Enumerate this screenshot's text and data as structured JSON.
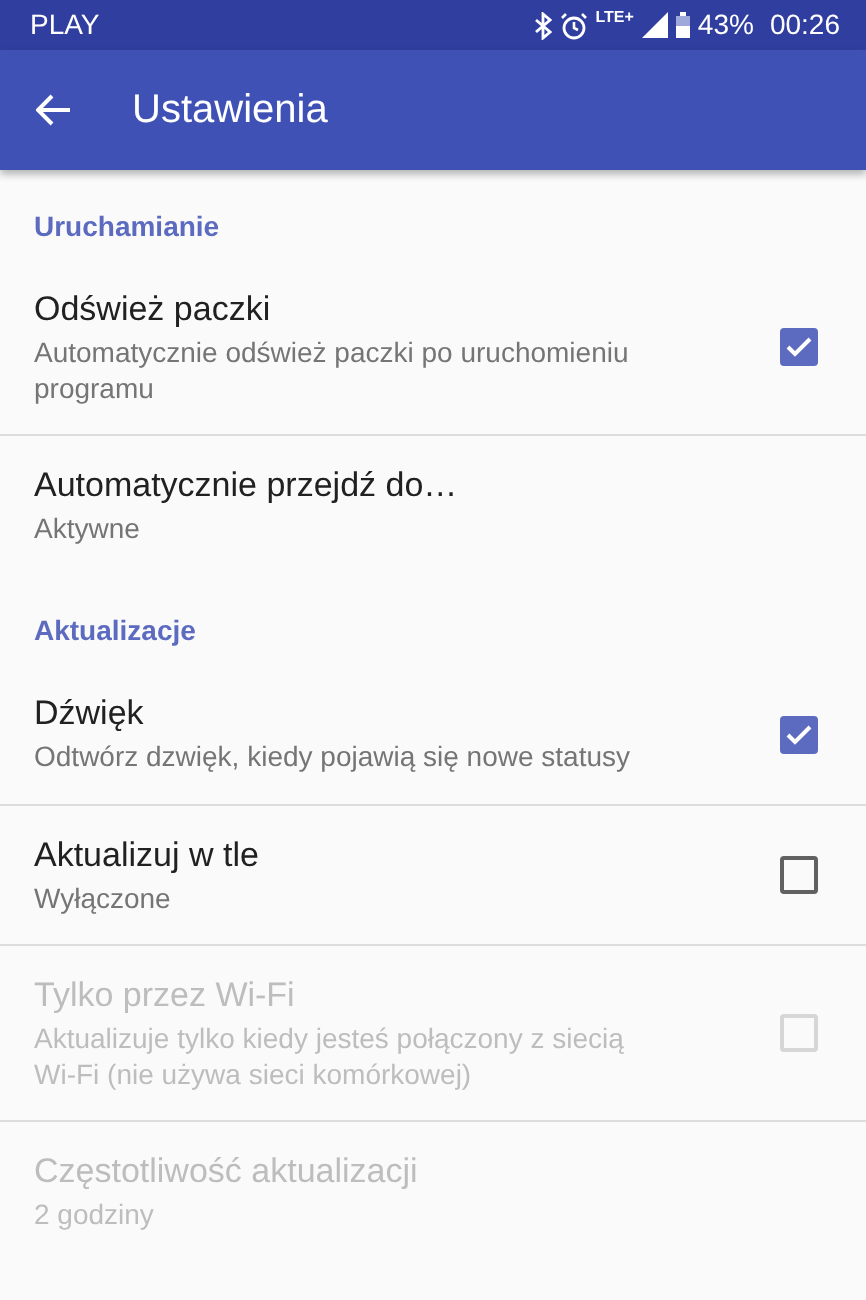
{
  "status_bar": {
    "carrier": "PLAY",
    "network": "LTE+",
    "battery": "43%",
    "time": "00:26"
  },
  "app_bar": {
    "title": "Ustawienia"
  },
  "sections": [
    {
      "title": "Uruchamianie",
      "items": [
        {
          "kind": "checkbox",
          "title": "Odśwież paczki",
          "summary": "Automatycznie odśwież paczki po uruchomieniu programu",
          "checked": true,
          "disabled": false
        },
        {
          "kind": "plain",
          "title": "Automatycznie przejdź do…",
          "summary": "Aktywne",
          "disabled": false
        }
      ]
    },
    {
      "title": "Aktualizacje",
      "items": [
        {
          "kind": "checkbox",
          "title": "Dźwięk",
          "summary": "Odtwórz dzwięk, kiedy pojawią się nowe statusy",
          "checked": true,
          "disabled": false
        },
        {
          "kind": "checkbox",
          "title": "Aktualizuj w tle",
          "summary": "Wyłączone",
          "checked": false,
          "disabled": false
        },
        {
          "kind": "checkbox",
          "title": "Tylko przez Wi-Fi",
          "summary": "Aktualizuje tylko kiedy jesteś połączony z siecią Wi-Fi (nie używa sieci komórkowej)",
          "checked": false,
          "disabled": true
        },
        {
          "kind": "plain",
          "title": "Częstotliwość aktualizacji",
          "summary": "2 godziny",
          "disabled": true
        }
      ]
    }
  ]
}
